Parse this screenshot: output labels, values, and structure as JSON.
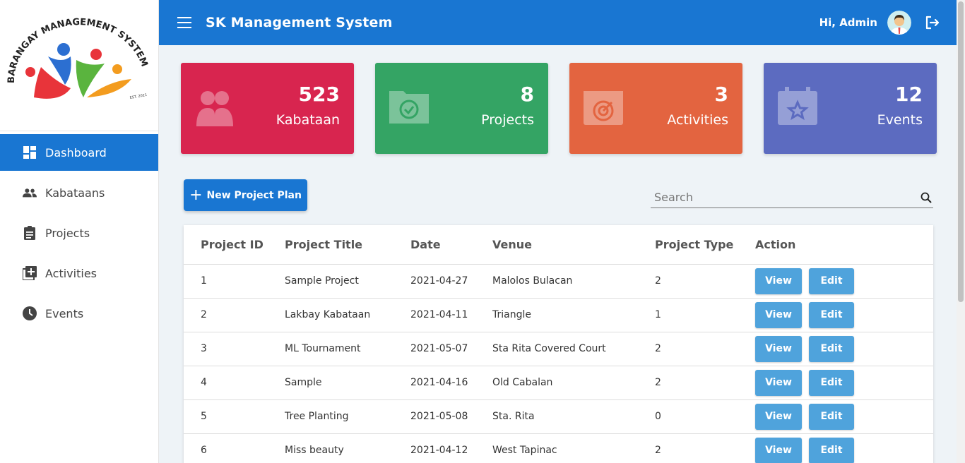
{
  "app": {
    "title": "SK Management System",
    "logo_text": "BARANGAY MANAGEMENT SYSTEM",
    "logo_subtext": "EST. 2021"
  },
  "header": {
    "greeting": "Hi, Admin",
    "menu_icon": "hamburger-icon",
    "logout_icon": "logout-icon"
  },
  "sidebar": {
    "items": [
      {
        "label": "Dashboard",
        "icon": "dashboard-icon",
        "active": true
      },
      {
        "label": "Kabataans",
        "icon": "people-icon",
        "active": false
      },
      {
        "label": "Projects",
        "icon": "clipboard-icon",
        "active": false
      },
      {
        "label": "Activities",
        "icon": "add-box-icon",
        "active": false
      },
      {
        "label": "Events",
        "icon": "clock-icon",
        "active": false
      }
    ]
  },
  "cards": [
    {
      "value": "523",
      "label": "Kabataan",
      "color": "#d8254f",
      "icon": "youth-icon"
    },
    {
      "value": "8",
      "label": "Projects",
      "color": "#34a464",
      "icon": "folder-check-icon"
    },
    {
      "value": "3",
      "label": "Activities",
      "color": "#e36440",
      "icon": "target-calendar-icon"
    },
    {
      "value": "12",
      "label": "Events",
      "color": "#5c6bc0",
      "icon": "star-calendar-icon"
    }
  ],
  "actions": {
    "new_project_label": "New Project Plan",
    "search_placeholder": "Search"
  },
  "table": {
    "headers": [
      "Project ID",
      "Project Title",
      "Date",
      "Venue",
      "Project Type",
      "Action"
    ],
    "rows": [
      {
        "id": "1",
        "title": "Sample Project",
        "date": "2021-04-27",
        "venue": "Malolos Bulacan",
        "type": "2"
      },
      {
        "id": "2",
        "title": "Lakbay Kabataan",
        "date": "2021-04-11",
        "venue": "Triangle",
        "type": "1"
      },
      {
        "id": "3",
        "title": "ML Tournament",
        "date": "2021-05-07",
        "venue": "Sta Rita Covered Court",
        "type": "2"
      },
      {
        "id": "4",
        "title": "Sample",
        "date": "2021-04-16",
        "venue": "Old Cabalan",
        "type": "2"
      },
      {
        "id": "5",
        "title": "Tree Planting",
        "date": "2021-05-08",
        "venue": "Sta. Rita",
        "type": "0"
      },
      {
        "id": "6",
        "title": "Miss beauty",
        "date": "2021-04-12",
        "venue": "West Tapinac",
        "type": "2"
      }
    ],
    "view_label": "View",
    "edit_label": "Edit"
  }
}
